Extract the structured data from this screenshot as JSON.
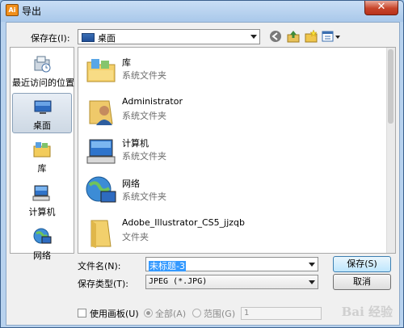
{
  "window": {
    "app_icon_text": "Ai",
    "title": "导出",
    "close_glyph": "✕"
  },
  "toolbar": {
    "lookin_label": "保存在(I):",
    "lookin_value": "桌面",
    "icons": [
      "back-icon",
      "up-folder-icon",
      "new-folder-icon",
      "view-menu-icon"
    ]
  },
  "places": [
    {
      "label": "最近访问的位置",
      "icon": "recent-places-icon"
    },
    {
      "label": "桌面",
      "icon": "desktop-icon",
      "selected": true
    },
    {
      "label": "库",
      "icon": "libraries-icon"
    },
    {
      "label": "计算机",
      "icon": "computer-icon"
    },
    {
      "label": "网络",
      "icon": "network-icon"
    }
  ],
  "files": [
    {
      "name": "库",
      "type": "系统文件夹",
      "icon": "libraries-folder-icon"
    },
    {
      "name": "Administrator",
      "type": "系统文件夹",
      "icon": "user-folder-icon"
    },
    {
      "name": "计算机",
      "type": "系统文件夹",
      "icon": "computer-icon"
    },
    {
      "name": "网络",
      "type": "系统文件夹",
      "icon": "network-icon"
    },
    {
      "name": "Adobe_Illustrator_CS5_jjzqb",
      "type": "文件夹",
      "icon": "folder-icon"
    }
  ],
  "form": {
    "filename_label": "文件名(N):",
    "filename_value": "未标题-3",
    "filetype_label": "保存类型(T):",
    "filetype_value": "JPEG (*.JPG)"
  },
  "buttons": {
    "save": "保存(S)",
    "cancel": "取消"
  },
  "options": {
    "use_artboards": "使用画板(U)",
    "all": "全部(A)",
    "range": "范围(G)",
    "range_value": "1"
  },
  "watermark": "Bai 经验"
}
